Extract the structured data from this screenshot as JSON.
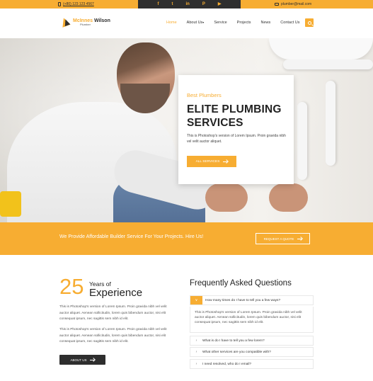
{
  "topbar": {
    "phone": "(+80) 123 123 4567",
    "social": [
      "f",
      "t",
      "in",
      "P",
      "▶"
    ],
    "email": "plumber@mail.com"
  },
  "header": {
    "logo_first": "McInnes",
    "logo_last": "Wilson",
    "logo_sub": "Plumber",
    "nav": [
      "Home",
      "About Us",
      "Service",
      "Projects",
      "News",
      "Contact Us"
    ],
    "active_nav": "Home"
  },
  "hero": {
    "kicker": "Best Plumbers",
    "title": "ELITE PLUMBING SERVICES",
    "desc": "This is Photoshop's version of Lorem Ipsum. Proin gravida nibh vel velit auctor aliquet.",
    "button": "ALL SERVICES"
  },
  "cta": {
    "text": "We Provide Affordable Builder Service For Your Projects. Hire Us!",
    "button": "REQUEST A QUOTE"
  },
  "experience": {
    "number": "25",
    "small": "Years of",
    "big": "Experience",
    "p1": "This is Photoshop's version of Lorem Ipsum. Proin gravida nibh vel velit auctor aliquet. Aenean sollicitudin, lorem quis bibendum auctor, nisi elit consequat ipsum, nec sagittis sem nibh id elit.",
    "p2": "This is Photoshop's version of Lorem Ipsum. Proin gravida nibh vel velit auctor aliquet. Aenean sollicitudin, lorem quis bibendum auctor, nisi elit consequat ipsum, nec sagittis sem nibh id elit.",
    "button": "ABOUT US"
  },
  "faq": {
    "title": "Frequently Asked Questions",
    "items": [
      {
        "q": "How many times do I have to tell you a few ways?",
        "open": true
      },
      {
        "q": "What is do I have to tell you a few lorem?",
        "open": false
      },
      {
        "q": "What other services are you compatible with?",
        "open": false
      },
      {
        "q": "I need resolved, who do I email?",
        "open": false
      }
    ],
    "answer": "This is Photoshop's version of Lorem Ipsum. Proin gravida nibh vel velit auctor aliquet. Aenean sollicitudin, lorem quis bibendum auctor, nisi elit consequat ipsum, nec sagittis sem nibh id elit."
  },
  "colors": {
    "accent": "#f7ad32",
    "dark": "#2e2e2e"
  },
  "icons": {
    "phone": "phone-icon",
    "mail": "mail-icon",
    "search": "search-icon",
    "arrow": "arrow-right-icon",
    "chevron": "chevron-right-icon",
    "chevron_open": "chevron-down-icon"
  }
}
